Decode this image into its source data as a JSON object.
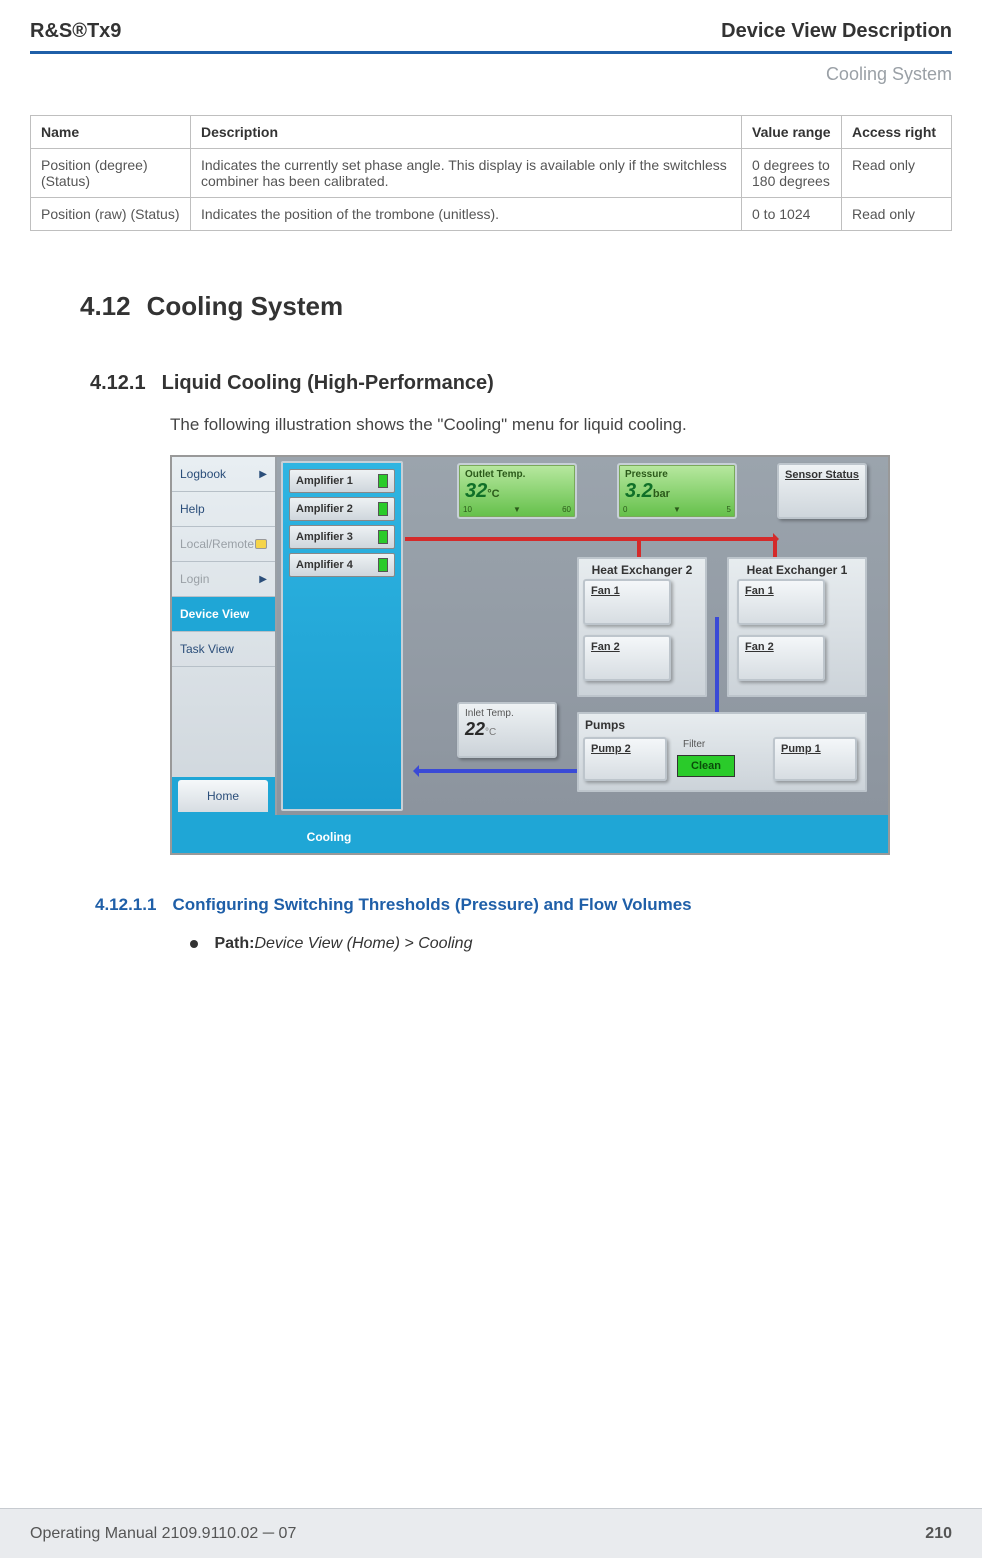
{
  "header": {
    "brand_line": "R&S®Tx9",
    "chapter": "Device View Description",
    "breadcrumb": "Cooling System"
  },
  "table": {
    "headers": {
      "name": "Name",
      "desc": "Description",
      "range": "Value range",
      "access": "Access right"
    },
    "rows": [
      {
        "name": "Position (degree) (Sta­tus)",
        "desc": "Indicates the currently set phase angle. This display is available only if the switchless combiner has been cali­brated.",
        "range": "0 degrees to 180 degrees",
        "access": "Read only"
      },
      {
        "name": "Position (raw) (Status)",
        "desc": "Indicates the position of the trombone (unitless).",
        "range": "0 to 1024",
        "access": "Read only"
      }
    ]
  },
  "sections": {
    "main_num": "4.12",
    "main_title": "Cooling System",
    "sub_num": "4.12.1",
    "sub_title": "Liquid Cooling (High-Performance)",
    "intro_text": "The following illustration shows the \"Cooling\" menu for liquid cooling.",
    "subsub_num": "4.12.1.1",
    "subsub_title": "Configuring Switching Thresholds (Pressure) and Flow Volumes",
    "path_label": "Path:",
    "path_value": "Device View (Home) > Cooling"
  },
  "ui": {
    "sidebar": {
      "items": [
        {
          "label": "Logbook"
        },
        {
          "label": "Help"
        },
        {
          "label": "Local/Remote"
        },
        {
          "label": "Login"
        },
        {
          "label": "Device View"
        },
        {
          "label": "Task View"
        }
      ],
      "home_tab": "Home",
      "cooling_tab": "Cooling"
    },
    "amplifiers": [
      "Amplifier 1",
      "Amplifier 2",
      "Amplifier 3",
      "Amplifier 4"
    ],
    "outlet": {
      "label": "Outlet Temp.",
      "value": "32",
      "unit": "°C",
      "min": "10",
      "max": "60"
    },
    "pressure": {
      "label": "Pressure",
      "value": "3.2",
      "unit": "bar",
      "min": "0",
      "max": "5"
    },
    "sensor_status": "Sensor Status",
    "hx1": {
      "title": "Heat Exchanger 1",
      "fan1": "Fan 1",
      "fan2": "Fan 2"
    },
    "hx2": {
      "title": "Heat Exchanger 2",
      "fan1": "Fan 1",
      "fan2": "Fan 2"
    },
    "inlet": {
      "label": "Inlet Temp.",
      "value": "22",
      "unit": "°C"
    },
    "pumps": {
      "title": "Pumps",
      "pump1": "Pump 1",
      "pump2": "Pump 2",
      "filter": "Filter",
      "clean": "Clean"
    }
  },
  "footer": {
    "left": "Operating Manual 2109.9110.02 ─ 07",
    "right": "210"
  }
}
